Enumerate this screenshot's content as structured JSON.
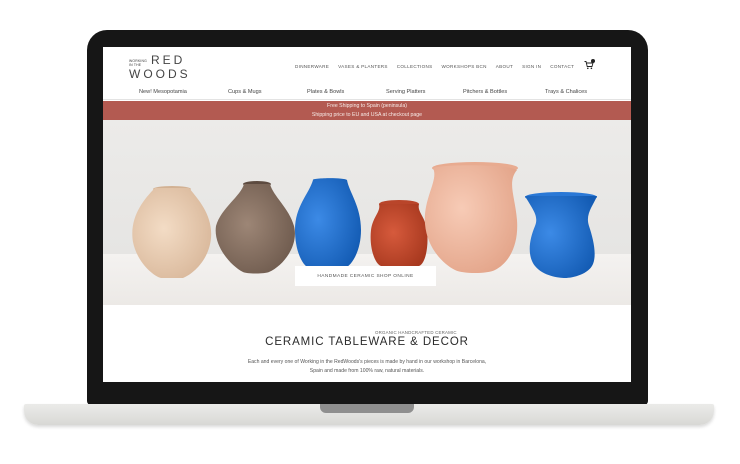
{
  "logo": {
    "small_line1": "WORKING",
    "small_line2": "IN THE",
    "word1": "RED",
    "word2": "WOODS"
  },
  "top_nav": [
    "DINNERWARE",
    "VASES & PLANTERS",
    "COLLECTIONS",
    "WORKSHOPS BCN",
    "ABOUT",
    "SIGN IN",
    "CONTACT"
  ],
  "category_nav": [
    "New! Mesopotamia",
    "Cups & Mugs",
    "Plates & Bowls",
    "Serving Platters",
    "Pitchers & Bottles",
    "Trays & Chalices"
  ],
  "banner": {
    "line1": "Free Shipping to Spain (peninsula)",
    "line2": "Shipping price to EU and USA at checkout page"
  },
  "hero": {
    "button_label": "HANDMADE CERAMIC SHOP ONLINE"
  },
  "content": {
    "tagline": "ORGANIC HANDCRAFTED CERAMIC",
    "headline": "CERAMIC TABLEWARE & DECOR",
    "description_line1": "Each and every one of Working in the RedWoods's pieces is made by hand in our workshop in Barcelona,",
    "description_line2": "Spain and made from 100% raw, natural materials."
  },
  "colors": {
    "banner": "#b35a51",
    "bezel": "#161616",
    "vase_blue": "#1f6fcf",
    "vase_terracotta": "#c7482e",
    "vase_pink": "#efb8a0",
    "vase_sand": "#e9cfb6",
    "vase_brown": "#8b7565"
  }
}
